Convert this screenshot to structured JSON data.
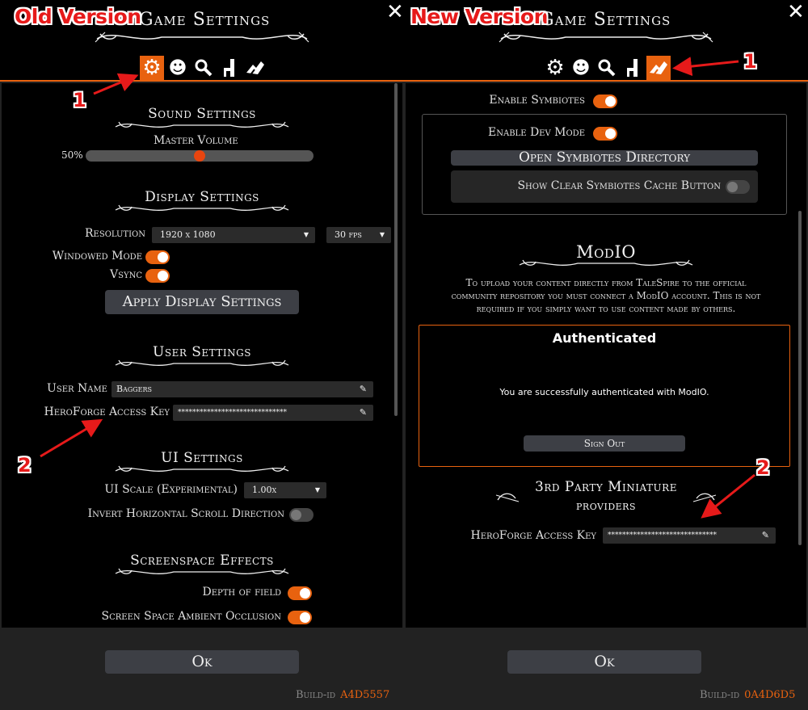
{
  "colors": {
    "accent": "#e8620f",
    "annotation": "#e61a1a",
    "background": "#000000",
    "panel": "#222222"
  },
  "left": {
    "version_tag": "Old Version",
    "title": "Game Settings",
    "tabs": [
      {
        "icon": "gear-icon",
        "active": true
      },
      {
        "icon": "character-icon",
        "active": false
      },
      {
        "icon": "magnifier-icon",
        "active": false
      },
      {
        "icon": "chair-icon",
        "active": false
      },
      {
        "icon": "handshake-icon",
        "active": false
      }
    ],
    "annotation_1": "1",
    "annotation_2": "2",
    "sound": {
      "title": "Sound Settings",
      "master_volume_label": "Master Volume",
      "volume_text": "50%",
      "volume_value": 0.5
    },
    "display": {
      "title": "Display Settings",
      "resolution_label": "Resolution",
      "resolution_value": "1920 x 1080",
      "fps_value": "30 fps",
      "windowed_label": "Windowed Mode",
      "windowed_on": true,
      "vsync_label": "Vsync",
      "vsync_on": true,
      "apply_button": "Apply Display Settings"
    },
    "user": {
      "title": "User Settings",
      "username_label": "User Name",
      "username_value": "Baggers",
      "heroforge_label": "HeroForge Access Key",
      "heroforge_value": "******************************"
    },
    "ui": {
      "title": "UI Settings",
      "scale_label": "UI Scale (Experimental)",
      "scale_value": "1.00x",
      "invert_label": "Invert Horizontal Scroll Direction",
      "invert_on": false
    },
    "screenspace": {
      "title": "Screenspace Effects",
      "dof_label": "Depth of field",
      "dof_on": true,
      "ssao_label": "Screen Space Ambient Occlusion",
      "ssao_on": true
    },
    "ok_button": "Ok",
    "build_label": "Build-id",
    "build_value": "A4D5557"
  },
  "right": {
    "version_tag": "New Version",
    "title": "Game Settings",
    "tabs": [
      {
        "icon": "gear-icon",
        "active": false
      },
      {
        "icon": "character-icon",
        "active": false
      },
      {
        "icon": "magnifier-icon",
        "active": false
      },
      {
        "icon": "chair-icon",
        "active": false
      },
      {
        "icon": "handshake-icon",
        "active": true
      }
    ],
    "annotation_1": "1",
    "annotation_2": "2",
    "symbiotes": {
      "enable_label": "Enable Symbiotes",
      "enable_on": true,
      "dev_mode_label": "Enable Dev Mode",
      "dev_mode_on": true,
      "open_dir_button": "Open Symbiotes Directory",
      "show_clear_label": "Show Clear Symbiotes Cache Button",
      "show_clear_on": false
    },
    "modio": {
      "title": "ModIO",
      "description_1": "To upload your content directly from TaleSpire to the official",
      "description_2": "community repository you must connect a ModIO account. This is not",
      "description_3": "required if you simply want to use content made by others.",
      "auth_title": "Authenticated",
      "auth_message": "You are successfully authenticated with ModIO.",
      "sign_out_button": "Sign Out"
    },
    "third_party": {
      "title_line1": "3rd Party Miniature",
      "title_line2": "providers",
      "heroforge_label": "HeroForge Access Key",
      "heroforge_value": "******************************"
    },
    "ok_button": "Ok",
    "build_label": "Build-id",
    "build_value": "0A4D6D5"
  }
}
